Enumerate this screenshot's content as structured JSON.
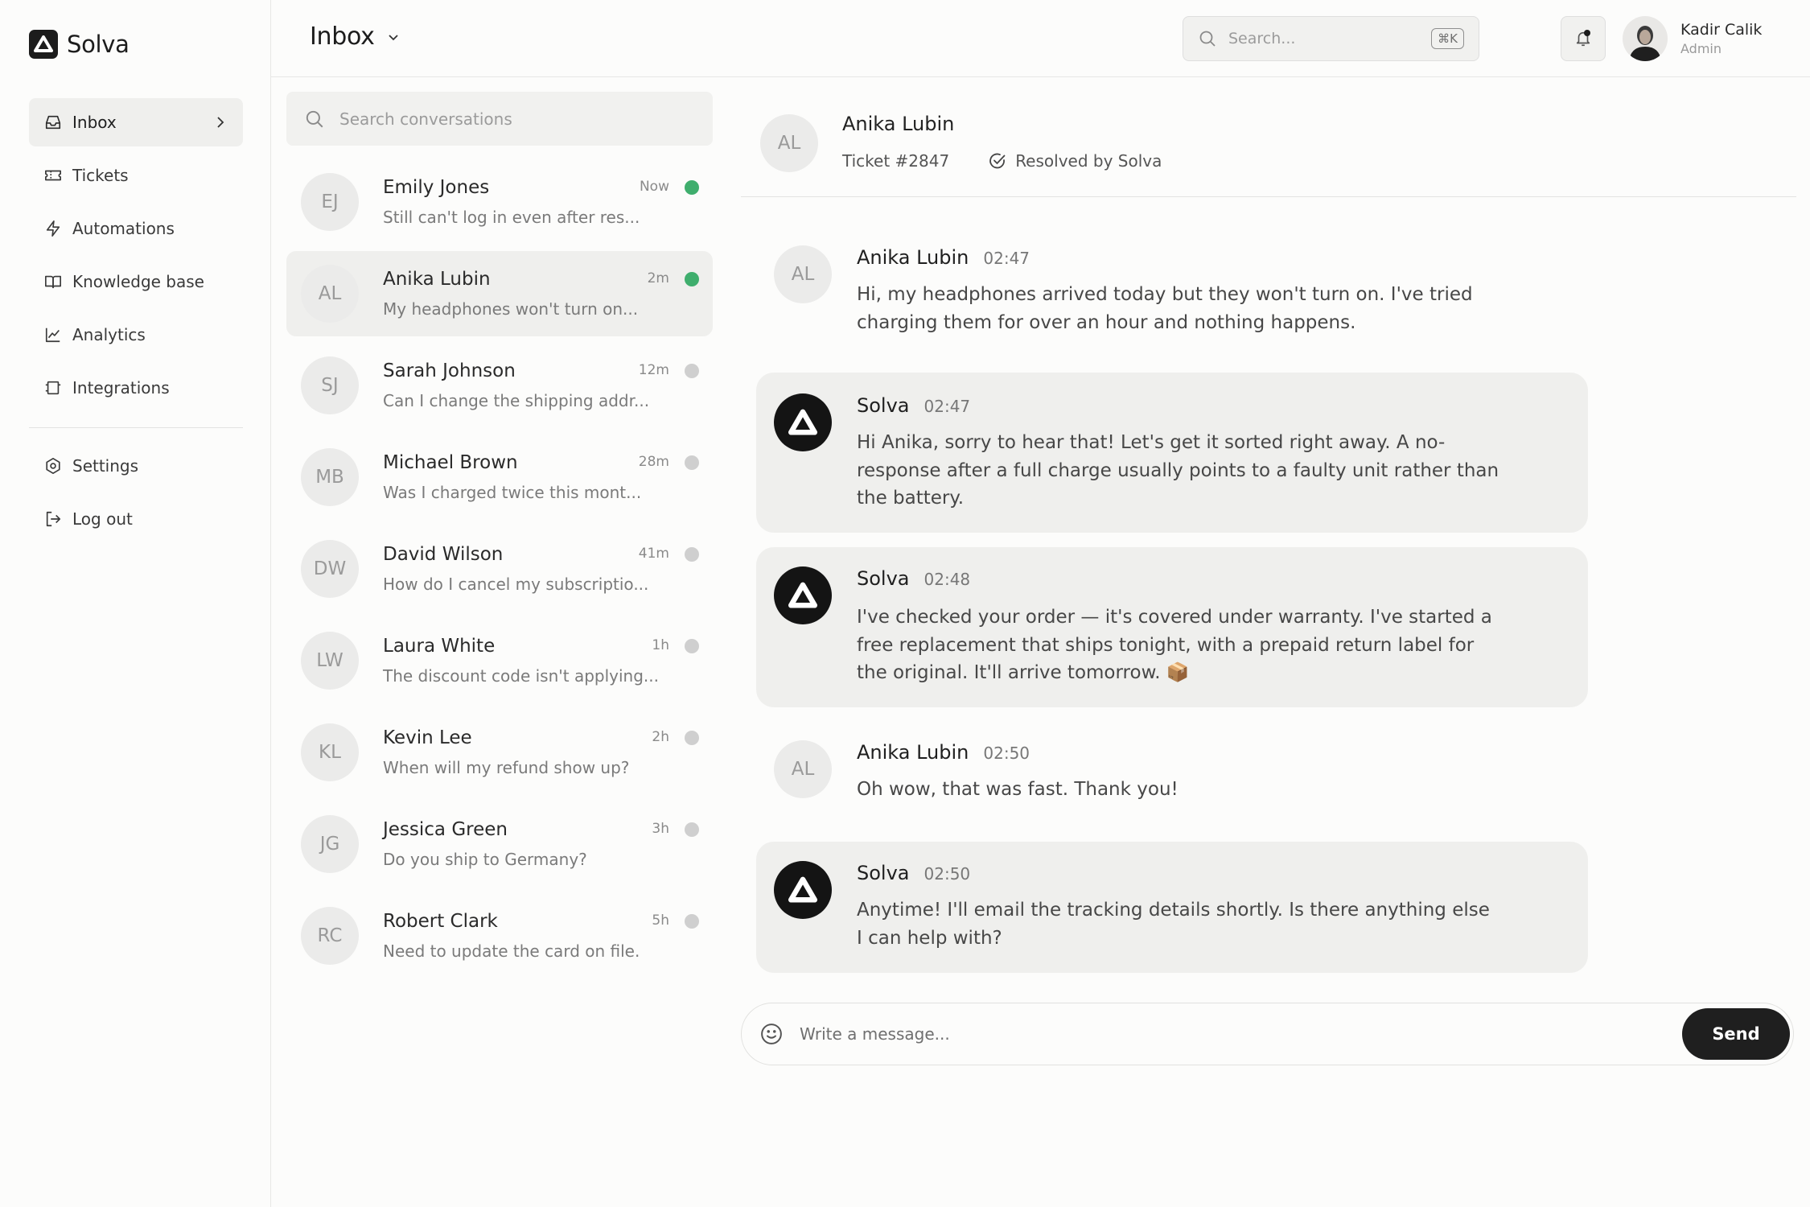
{
  "app": {
    "brand": "Solva"
  },
  "sidebar": {
    "items": [
      {
        "label": "Inbox",
        "icon": "inbox-icon"
      },
      {
        "label": "Tickets",
        "icon": "ticket-icon"
      },
      {
        "label": "Automations",
        "icon": "bolt-icon"
      },
      {
        "label": "Knowledge base",
        "icon": "book-icon"
      },
      {
        "label": "Analytics",
        "icon": "chart-icon"
      },
      {
        "label": "Integrations",
        "icon": "integrations-icon"
      }
    ],
    "footer_items": [
      {
        "label": "Settings",
        "icon": "gear-icon"
      },
      {
        "label": "Log out",
        "icon": "logout-icon"
      }
    ]
  },
  "header": {
    "title": "Inbox",
    "search_placeholder": "Search...",
    "shortcut": "⌘K",
    "user": {
      "name": "Kadir Calik",
      "role": "Admin"
    }
  },
  "conversations": {
    "search_placeholder": "Search conversations",
    "items": [
      {
        "initials": "EJ",
        "name": "Emily Jones",
        "preview": "Still can't log in even after res...",
        "time": "Now",
        "online": true
      },
      {
        "initials": "AL",
        "name": "Anika Lubin",
        "preview": "My headphones won't turn on...",
        "time": "2m",
        "online": true
      },
      {
        "initials": "SJ",
        "name": "Sarah Johnson",
        "preview": "Can I change the shipping addr...",
        "time": "12m",
        "online": false
      },
      {
        "initials": "MB",
        "name": "Michael Brown",
        "preview": "Was I charged twice this mont...",
        "time": "28m",
        "online": false
      },
      {
        "initials": "DW",
        "name": "David Wilson",
        "preview": "How do I cancel my subscriptio...",
        "time": "41m",
        "online": false
      },
      {
        "initials": "LW",
        "name": "Laura White",
        "preview": "The discount code isn't applying...",
        "time": "1h",
        "online": false
      },
      {
        "initials": "KL",
        "name": "Kevin Lee",
        "preview": "When will my refund show up?",
        "time": "2h",
        "online": false
      },
      {
        "initials": "JG",
        "name": "Jessica Green",
        "preview": "Do you ship to Germany?",
        "time": "3h",
        "online": false
      },
      {
        "initials": "RC",
        "name": "Robert Clark",
        "preview": "Need to update the card on file.",
        "time": "5h",
        "online": false
      }
    ]
  },
  "chat": {
    "contact": {
      "initials": "AL",
      "name": "Anika Lubin"
    },
    "ticket": "Ticket #2847",
    "status": "Resolved by Solva",
    "messages": [
      {
        "role": "user",
        "initials": "AL",
        "author": "Anika Lubin",
        "time": "02:47",
        "text": "Hi, my headphones arrived today but they won't turn on. I've tried charging them for over an hour and nothing happens."
      },
      {
        "role": "bot",
        "author": "Solva",
        "time": "02:47",
        "text": "Hi Anika, sorry to hear that! Let's get it sorted right away. A no-response after a full charge usually points to a faulty unit rather than the battery."
      },
      {
        "role": "bot",
        "author": "Solva",
        "time": "02:48",
        "text": "I've checked your order — it's covered under warranty. I've started a free replacement that ships tonight, with a prepaid return label for the original. It'll arrive tomorrow. 📦"
      },
      {
        "role": "user",
        "initials": "AL",
        "author": "Anika Lubin",
        "time": "02:50",
        "text": "Oh wow, that was fast. Thank you!"
      },
      {
        "role": "bot",
        "author": "Solva",
        "time": "02:50",
        "text": "Anytime! I'll email the tracking details shortly. Is there anything else I can help with?"
      }
    ],
    "composer_placeholder": "Write a message...",
    "send_label": "Send"
  }
}
